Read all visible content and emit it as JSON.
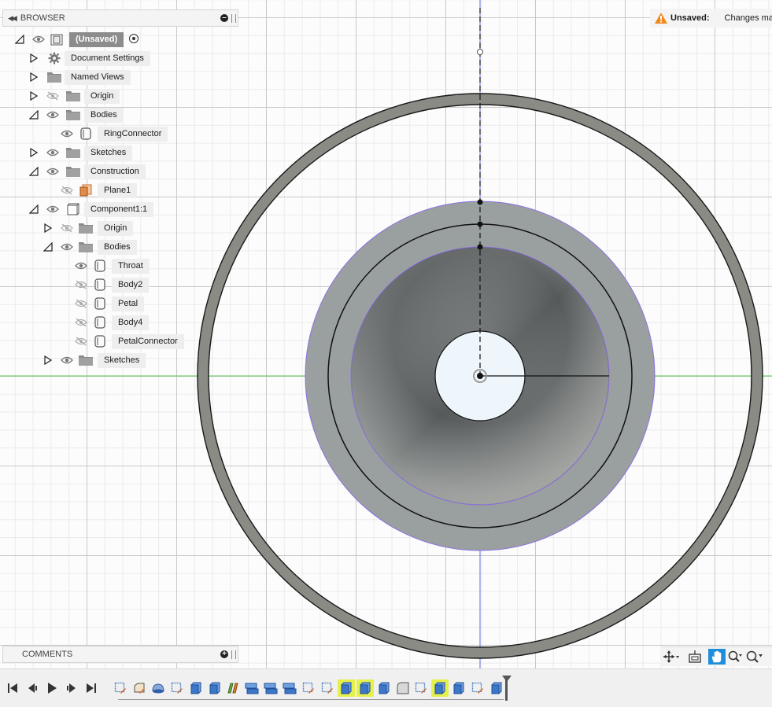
{
  "browser": {
    "title": "BROWSER",
    "rows": [
      {
        "id": "root",
        "label": "(Unsaved)",
        "depth": 0,
        "tri": "open",
        "eye": "visible",
        "icon": "component",
        "root": true
      },
      {
        "id": "doc-settings",
        "label": "Document Settings",
        "depth": 1,
        "tri": "closed",
        "eye": "none",
        "icon": "gear"
      },
      {
        "id": "named-views",
        "label": "Named Views",
        "depth": 1,
        "tri": "closed",
        "eye": "none",
        "icon": "folder"
      },
      {
        "id": "origin",
        "label": "Origin",
        "depth": 1,
        "tri": "closed",
        "eye": "hidden",
        "icon": "folder"
      },
      {
        "id": "bodies",
        "label": "Bodies",
        "depth": 1,
        "tri": "open",
        "eye": "visible",
        "icon": "folder"
      },
      {
        "id": "ringconnector",
        "label": "RingConnector",
        "depth": 2,
        "tri": "none",
        "eye": "visible",
        "icon": "body"
      },
      {
        "id": "sketches",
        "label": "Sketches",
        "depth": 1,
        "tri": "closed",
        "eye": "visible",
        "icon": "folder"
      },
      {
        "id": "construction",
        "label": "Construction",
        "depth": 1,
        "tri": "open",
        "eye": "visible",
        "icon": "folder"
      },
      {
        "id": "plane1",
        "label": "Plane1",
        "depth": 2,
        "tri": "none",
        "eye": "hidden",
        "icon": "plane"
      },
      {
        "id": "component1",
        "label": "Component1:1",
        "depth": 1,
        "tri": "open",
        "eye": "visible",
        "icon": "component-box"
      },
      {
        "id": "c-origin",
        "label": "Origin",
        "depth": 2,
        "tri": "closed",
        "eye": "hidden",
        "icon": "folder"
      },
      {
        "id": "c-bodies",
        "label": "Bodies",
        "depth": 2,
        "tri": "open",
        "eye": "visible",
        "icon": "folder"
      },
      {
        "id": "throat",
        "label": "Throat",
        "depth": 3,
        "tri": "none",
        "eye": "visible",
        "icon": "body"
      },
      {
        "id": "body2",
        "label": "Body2",
        "depth": 3,
        "tri": "none",
        "eye": "hidden",
        "icon": "body"
      },
      {
        "id": "petal",
        "label": "Petal",
        "depth": 3,
        "tri": "none",
        "eye": "hidden",
        "icon": "body"
      },
      {
        "id": "body4",
        "label": "Body4",
        "depth": 3,
        "tri": "none",
        "eye": "hidden",
        "icon": "body"
      },
      {
        "id": "petalconnector",
        "label": "PetalConnector",
        "depth": 3,
        "tri": "none",
        "eye": "hidden",
        "icon": "body"
      },
      {
        "id": "c-sketches",
        "label": "Sketches",
        "depth": 2,
        "tri": "closed",
        "eye": "visible",
        "icon": "folder"
      }
    ]
  },
  "unsaved": {
    "title": "Unsaved:",
    "message": "Changes ma"
  },
  "comments": {
    "title": "COMMENTS"
  },
  "navbar": {
    "buttons": [
      {
        "name": "orbit-button",
        "icon": "orbit-icon",
        "active": false
      },
      {
        "name": "look-at-button",
        "icon": "look-at-icon",
        "active": false
      },
      {
        "name": "pan-button",
        "icon": "hand-icon",
        "active": true
      },
      {
        "name": "zoom-button",
        "icon": "zoom-icon",
        "active": false
      },
      {
        "name": "fit-button",
        "icon": "zoom-window-icon",
        "active": false
      }
    ]
  },
  "timeline": {
    "controls": [
      "go-to-start",
      "step-back",
      "play",
      "step-forward",
      "go-to-end"
    ],
    "features": [
      {
        "icon": "sketch",
        "hl": false
      },
      {
        "icon": "sketch-spline",
        "hl": false
      },
      {
        "icon": "revolve",
        "hl": false
      },
      {
        "icon": "sketch",
        "hl": false
      },
      {
        "icon": "extrude",
        "hl": false
      },
      {
        "icon": "extrude",
        "hl": false
      },
      {
        "icon": "loft",
        "hl": false
      },
      {
        "icon": "combine",
        "hl": false
      },
      {
        "icon": "combine",
        "hl": false
      },
      {
        "icon": "combine",
        "hl": false
      },
      {
        "icon": "sketch",
        "hl": false
      },
      {
        "icon": "sketch",
        "hl": false
      },
      {
        "icon": "extrude",
        "hl": true
      },
      {
        "icon": "extrude",
        "hl": true
      },
      {
        "icon": "extrude",
        "hl": false
      },
      {
        "icon": "fillet",
        "hl": false
      },
      {
        "icon": "sketch",
        "hl": false
      },
      {
        "icon": "extrude",
        "hl": true
      },
      {
        "icon": "extrude",
        "hl": false
      },
      {
        "icon": "sketch",
        "hl": false
      },
      {
        "icon": "extrude",
        "hl": false
      }
    ]
  },
  "colors": {
    "accent": "#1f8fdb",
    "highlight": "#e5f04a",
    "ring": "#8b8b86",
    "flange": "#9aa0a0",
    "selection": "#8a6ee0",
    "axis_green": "#5bc85b",
    "axis_blue": "#5a6cdf"
  }
}
